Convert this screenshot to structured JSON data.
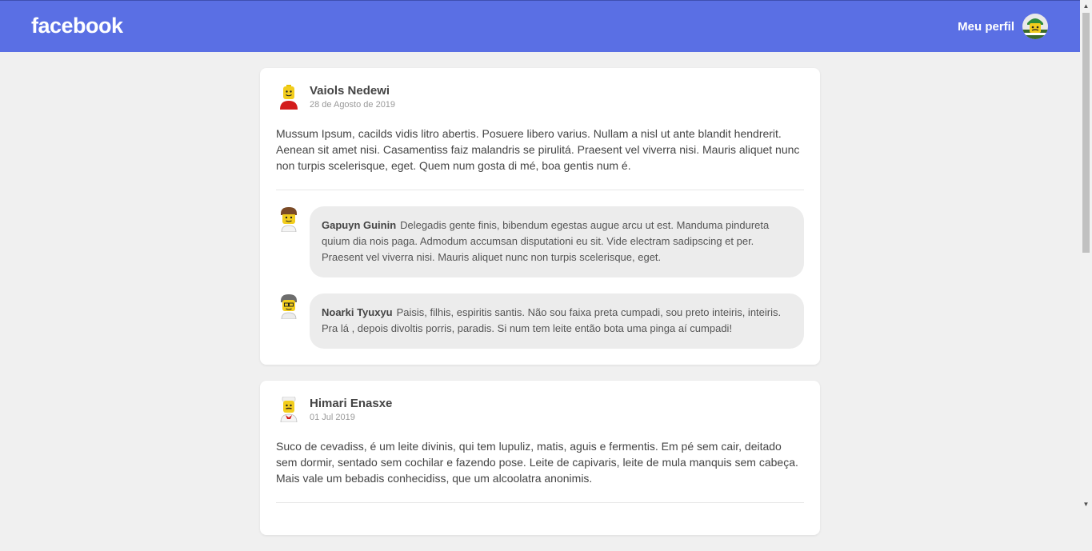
{
  "header": {
    "logo": "facebook",
    "profile_label": "Meu perfil"
  },
  "posts": [
    {
      "author": "Vaiols Nedewi",
      "date": "28 de Agosto de 2019",
      "body": "Mussum Ipsum, cacilds vidis litro abertis. Posuere libero varius. Nullam a nisl ut ante blandit hendrerit. Aenean sit amet nisi. Casamentiss faiz malandris se pirulitá. Praesent vel viverra nisi. Mauris aliquet nunc non turpis scelerisque, eget. Quem num gosta di mé, boa gentis num é.",
      "comments": [
        {
          "author": "Gapuyn Guinin",
          "text": "Delegadis gente finis, bibendum egestas augue arcu ut est. Manduma pindureta quium dia nois paga. Admodum accumsan disputationi eu sit. Vide electram sadipscing et per. Praesent vel viverra nisi. Mauris aliquet nunc non turpis scelerisque, eget."
        },
        {
          "author": "Noarki Tyuxyu",
          "text": "Paisis, filhis, espiritis santis. Não sou faixa preta cumpadi, sou preto inteiris, inteiris. Pra lá , depois divoltis porris, paradis. Si num tem leite então bota uma pinga aí cumpadi!"
        }
      ]
    },
    {
      "author": "Himari Enasxe",
      "date": "01 Jul 2019",
      "body": "Suco de cevadiss, é um leite divinis, qui tem lupuliz, matis, aguis e fermentis. Em pé sem cair, deitado sem dormir, sentado sem cochilar e fazendo pose. Leite de capivaris, leite de mula manquis sem cabeça. Mais vale um bebadis conhecidiss, que um alcoolatra anonimis."
    }
  ],
  "colors": {
    "header_bg": "#5a6fe4",
    "page_bg": "#f0f0f0",
    "bubble_bg": "#ececec"
  }
}
